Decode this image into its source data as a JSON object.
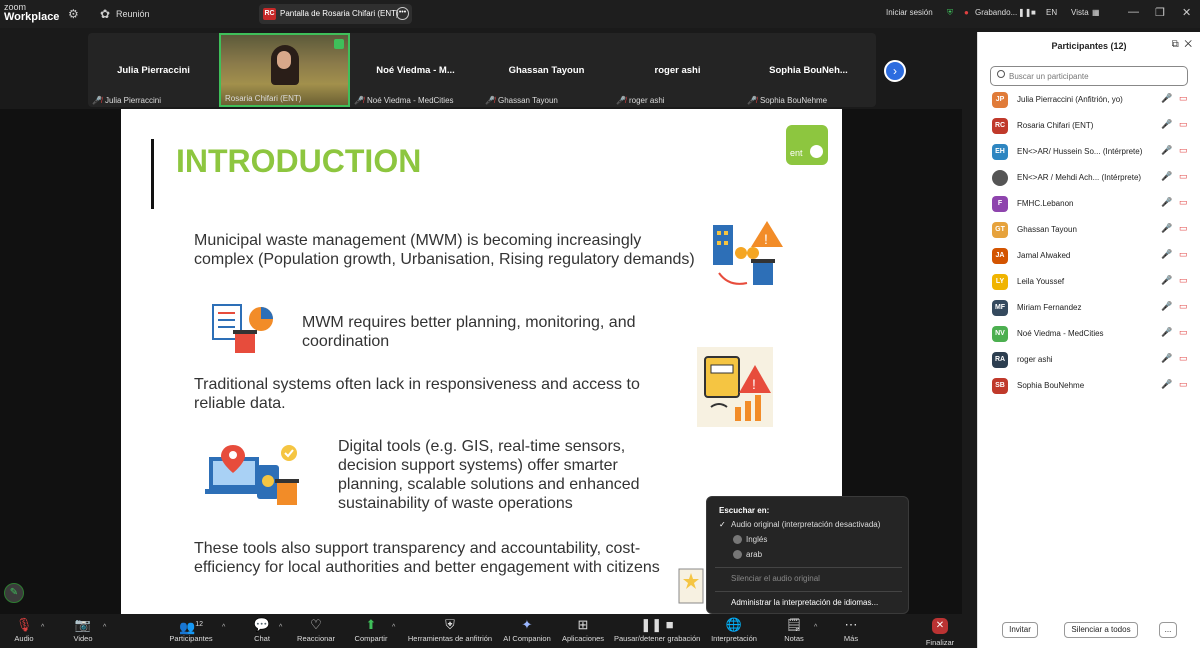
{
  "app": {
    "logo_line1": "zoom",
    "logo_line2": "Workplace",
    "meeting_label": "Reunión"
  },
  "share_chip": {
    "badge": "RC",
    "label": "Pantalla de Rosaria Chifari (ENT)"
  },
  "topbar_right": {
    "signin": "Iniciar sesión",
    "recording": "Grabando...",
    "lang": "EN",
    "view": "Vista"
  },
  "gallery": [
    {
      "name": "Julia Pierraccini",
      "label": "Julia Pierraccini"
    },
    {
      "name": "",
      "label": "Rosaria Chifari (ENT)"
    },
    {
      "name": "Noé Viedma - M...",
      "label": "Noé Viedma - MedCities"
    },
    {
      "name": "Ghassan Tayoun",
      "label": "Ghassan Tayoun"
    },
    {
      "name": "roger ashi",
      "label": "roger ashi"
    },
    {
      "name": "Sophia BouNeh...",
      "label": "Sophia BouNehme"
    }
  ],
  "slide": {
    "title": "INTRODUCTION",
    "logo_text": "ent",
    "p1": "Municipal waste management (MWM) is becoming increasingly complex (Population growth, Urbanisation, Rising regulatory demands)",
    "p2": "MWM requires better planning, monitoring, and coordination",
    "p3": "Traditional systems often lack in responsiveness and access to reliable data.",
    "p4": "Digital tools (e.g. GIS, real-time sensors, decision support systems) offer smarter planning, scalable solutions and enhanced sustainability of waste operations",
    "p5": "These tools also support transparency and accountability, cost-efficiency for local authorities and better engagement with citizens"
  },
  "interp_popup": {
    "header": "Escuchar en:",
    "original": "Audio original (interpretación desactivada)",
    "english": "Inglés",
    "arab": "arab",
    "mute_original": "Silenciar el audio original",
    "manage": "Administrar la interpretación de idiomas..."
  },
  "sidebar": {
    "title": "Participantes (12)",
    "search_placeholder": "Buscar un participante",
    "participants": [
      {
        "initials": "JP",
        "name": "Julia Pierraccini (Anfitrión, yo)",
        "color": "#e07b39"
      },
      {
        "initials": "RC",
        "name": "Rosaria Chifari (ENT)",
        "color": "#c0392b"
      },
      {
        "initials": "EH",
        "name": "EN<>AR/ Hussein So...  (Intérprete)",
        "color": "#2e86c1"
      },
      {
        "initials": "",
        "name": "EN<>AR / Mehdi Ach...  (Intérprete)",
        "color": "#555555"
      },
      {
        "initials": "F",
        "name": "FMHC.Lebanon",
        "color": "#8e44ad"
      },
      {
        "initials": "GT",
        "name": "Ghassan Tayoun",
        "color": "#e6a23c"
      },
      {
        "initials": "JA",
        "name": "Jamal Alwaked",
        "color": "#d35400"
      },
      {
        "initials": "LY",
        "name": "Leila Youssef",
        "color": "#f0b400"
      },
      {
        "initials": "MF",
        "name": "Miriam Fernandez",
        "color": "#34495e"
      },
      {
        "initials": "NV",
        "name": "Noé Viedma - MedCities",
        "color": "#4caf50"
      },
      {
        "initials": "RA",
        "name": "roger ashi",
        "color": "#2c3e50"
      },
      {
        "initials": "SB",
        "name": "Sophia BouNehme",
        "color": "#c0392b"
      }
    ],
    "invite": "Invitar",
    "mute_all": "Silenciar a todos",
    "more": "..."
  },
  "toolbar": {
    "audio": "Audio",
    "video": "Video",
    "participants": "Participantes",
    "participants_count": "12",
    "chat": "Chat",
    "react": "Reaccionar",
    "share": "Compartir",
    "host_tools": "Herramientas de anfitrión",
    "ai": "AI Companion",
    "apps": "Aplicaciones",
    "record": "Pausar/detener grabación",
    "interp": "Interpretación",
    "notes": "Notas",
    "more": "Más",
    "end": "Finalizar"
  }
}
